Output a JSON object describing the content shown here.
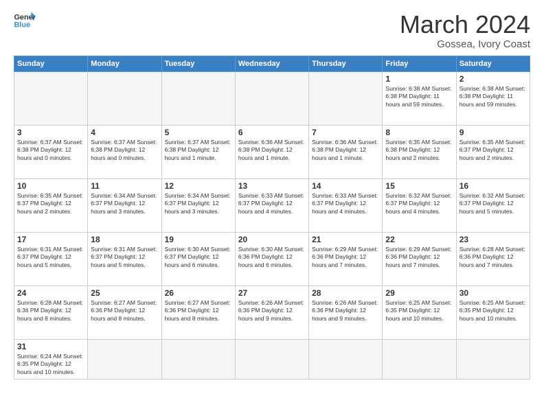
{
  "header": {
    "logo_general": "General",
    "logo_blue": "Blue",
    "title": "March 2024",
    "subtitle": "Gossea, Ivory Coast"
  },
  "weekdays": [
    "Sunday",
    "Monday",
    "Tuesday",
    "Wednesday",
    "Thursday",
    "Friday",
    "Saturday"
  ],
  "weeks": [
    [
      {
        "day": "",
        "info": ""
      },
      {
        "day": "",
        "info": ""
      },
      {
        "day": "",
        "info": ""
      },
      {
        "day": "",
        "info": ""
      },
      {
        "day": "",
        "info": ""
      },
      {
        "day": "1",
        "info": "Sunrise: 6:38 AM\nSunset: 6:38 PM\nDaylight: 11 hours\nand 59 minutes."
      },
      {
        "day": "2",
        "info": "Sunrise: 6:38 AM\nSunset: 6:38 PM\nDaylight: 11 hours\nand 59 minutes."
      }
    ],
    [
      {
        "day": "3",
        "info": "Sunrise: 6:37 AM\nSunset: 6:38 PM\nDaylight: 12 hours\nand 0 minutes."
      },
      {
        "day": "4",
        "info": "Sunrise: 6:37 AM\nSunset: 6:38 PM\nDaylight: 12 hours\nand 0 minutes."
      },
      {
        "day": "5",
        "info": "Sunrise: 6:37 AM\nSunset: 6:38 PM\nDaylight: 12 hours\nand 1 minute."
      },
      {
        "day": "6",
        "info": "Sunrise: 6:36 AM\nSunset: 6:38 PM\nDaylight: 12 hours\nand 1 minute."
      },
      {
        "day": "7",
        "info": "Sunrise: 6:36 AM\nSunset: 6:38 PM\nDaylight: 12 hours\nand 1 minute."
      },
      {
        "day": "8",
        "info": "Sunrise: 6:35 AM\nSunset: 6:38 PM\nDaylight: 12 hours\nand 2 minutes."
      },
      {
        "day": "9",
        "info": "Sunrise: 6:35 AM\nSunset: 6:37 PM\nDaylight: 12 hours\nand 2 minutes."
      }
    ],
    [
      {
        "day": "10",
        "info": "Sunrise: 6:35 AM\nSunset: 6:37 PM\nDaylight: 12 hours\nand 2 minutes."
      },
      {
        "day": "11",
        "info": "Sunrise: 6:34 AM\nSunset: 6:37 PM\nDaylight: 12 hours\nand 3 minutes."
      },
      {
        "day": "12",
        "info": "Sunrise: 6:34 AM\nSunset: 6:37 PM\nDaylight: 12 hours\nand 3 minutes."
      },
      {
        "day": "13",
        "info": "Sunrise: 6:33 AM\nSunset: 6:37 PM\nDaylight: 12 hours\nand 4 minutes."
      },
      {
        "day": "14",
        "info": "Sunrise: 6:33 AM\nSunset: 6:37 PM\nDaylight: 12 hours\nand 4 minutes."
      },
      {
        "day": "15",
        "info": "Sunrise: 6:32 AM\nSunset: 6:37 PM\nDaylight: 12 hours\nand 4 minutes."
      },
      {
        "day": "16",
        "info": "Sunrise: 6:32 AM\nSunset: 6:37 PM\nDaylight: 12 hours\nand 5 minutes."
      }
    ],
    [
      {
        "day": "17",
        "info": "Sunrise: 6:31 AM\nSunset: 6:37 PM\nDaylight: 12 hours\nand 5 minutes."
      },
      {
        "day": "18",
        "info": "Sunrise: 6:31 AM\nSunset: 6:37 PM\nDaylight: 12 hours\nand 5 minutes."
      },
      {
        "day": "19",
        "info": "Sunrise: 6:30 AM\nSunset: 6:37 PM\nDaylight: 12 hours\nand 6 minutes."
      },
      {
        "day": "20",
        "info": "Sunrise: 6:30 AM\nSunset: 6:36 PM\nDaylight: 12 hours\nand 6 minutes."
      },
      {
        "day": "21",
        "info": "Sunrise: 6:29 AM\nSunset: 6:36 PM\nDaylight: 12 hours\nand 7 minutes."
      },
      {
        "day": "22",
        "info": "Sunrise: 6:29 AM\nSunset: 6:36 PM\nDaylight: 12 hours\nand 7 minutes."
      },
      {
        "day": "23",
        "info": "Sunrise: 6:28 AM\nSunset: 6:36 PM\nDaylight: 12 hours\nand 7 minutes."
      }
    ],
    [
      {
        "day": "24",
        "info": "Sunrise: 6:28 AM\nSunset: 6:36 PM\nDaylight: 12 hours\nand 8 minutes."
      },
      {
        "day": "25",
        "info": "Sunrise: 6:27 AM\nSunset: 6:36 PM\nDaylight: 12 hours\nand 8 minutes."
      },
      {
        "day": "26",
        "info": "Sunrise: 6:27 AM\nSunset: 6:36 PM\nDaylight: 12 hours\nand 8 minutes."
      },
      {
        "day": "27",
        "info": "Sunrise: 6:26 AM\nSunset: 6:36 PM\nDaylight: 12 hours\nand 9 minutes."
      },
      {
        "day": "28",
        "info": "Sunrise: 6:26 AM\nSunset: 6:36 PM\nDaylight: 12 hours\nand 9 minutes."
      },
      {
        "day": "29",
        "info": "Sunrise: 6:25 AM\nSunset: 6:35 PM\nDaylight: 12 hours\nand 10 minutes."
      },
      {
        "day": "30",
        "info": "Sunrise: 6:25 AM\nSunset: 6:35 PM\nDaylight: 12 hours\nand 10 minutes."
      }
    ],
    [
      {
        "day": "31",
        "info": "Sunrise: 6:24 AM\nSunset: 6:35 PM\nDaylight: 12 hours\nand 10 minutes."
      },
      {
        "day": "",
        "info": ""
      },
      {
        "day": "",
        "info": ""
      },
      {
        "day": "",
        "info": ""
      },
      {
        "day": "",
        "info": ""
      },
      {
        "day": "",
        "info": ""
      },
      {
        "day": "",
        "info": ""
      }
    ]
  ],
  "colors": {
    "header_bg": "#3a7fc1",
    "accent": "#3a8fc7"
  }
}
